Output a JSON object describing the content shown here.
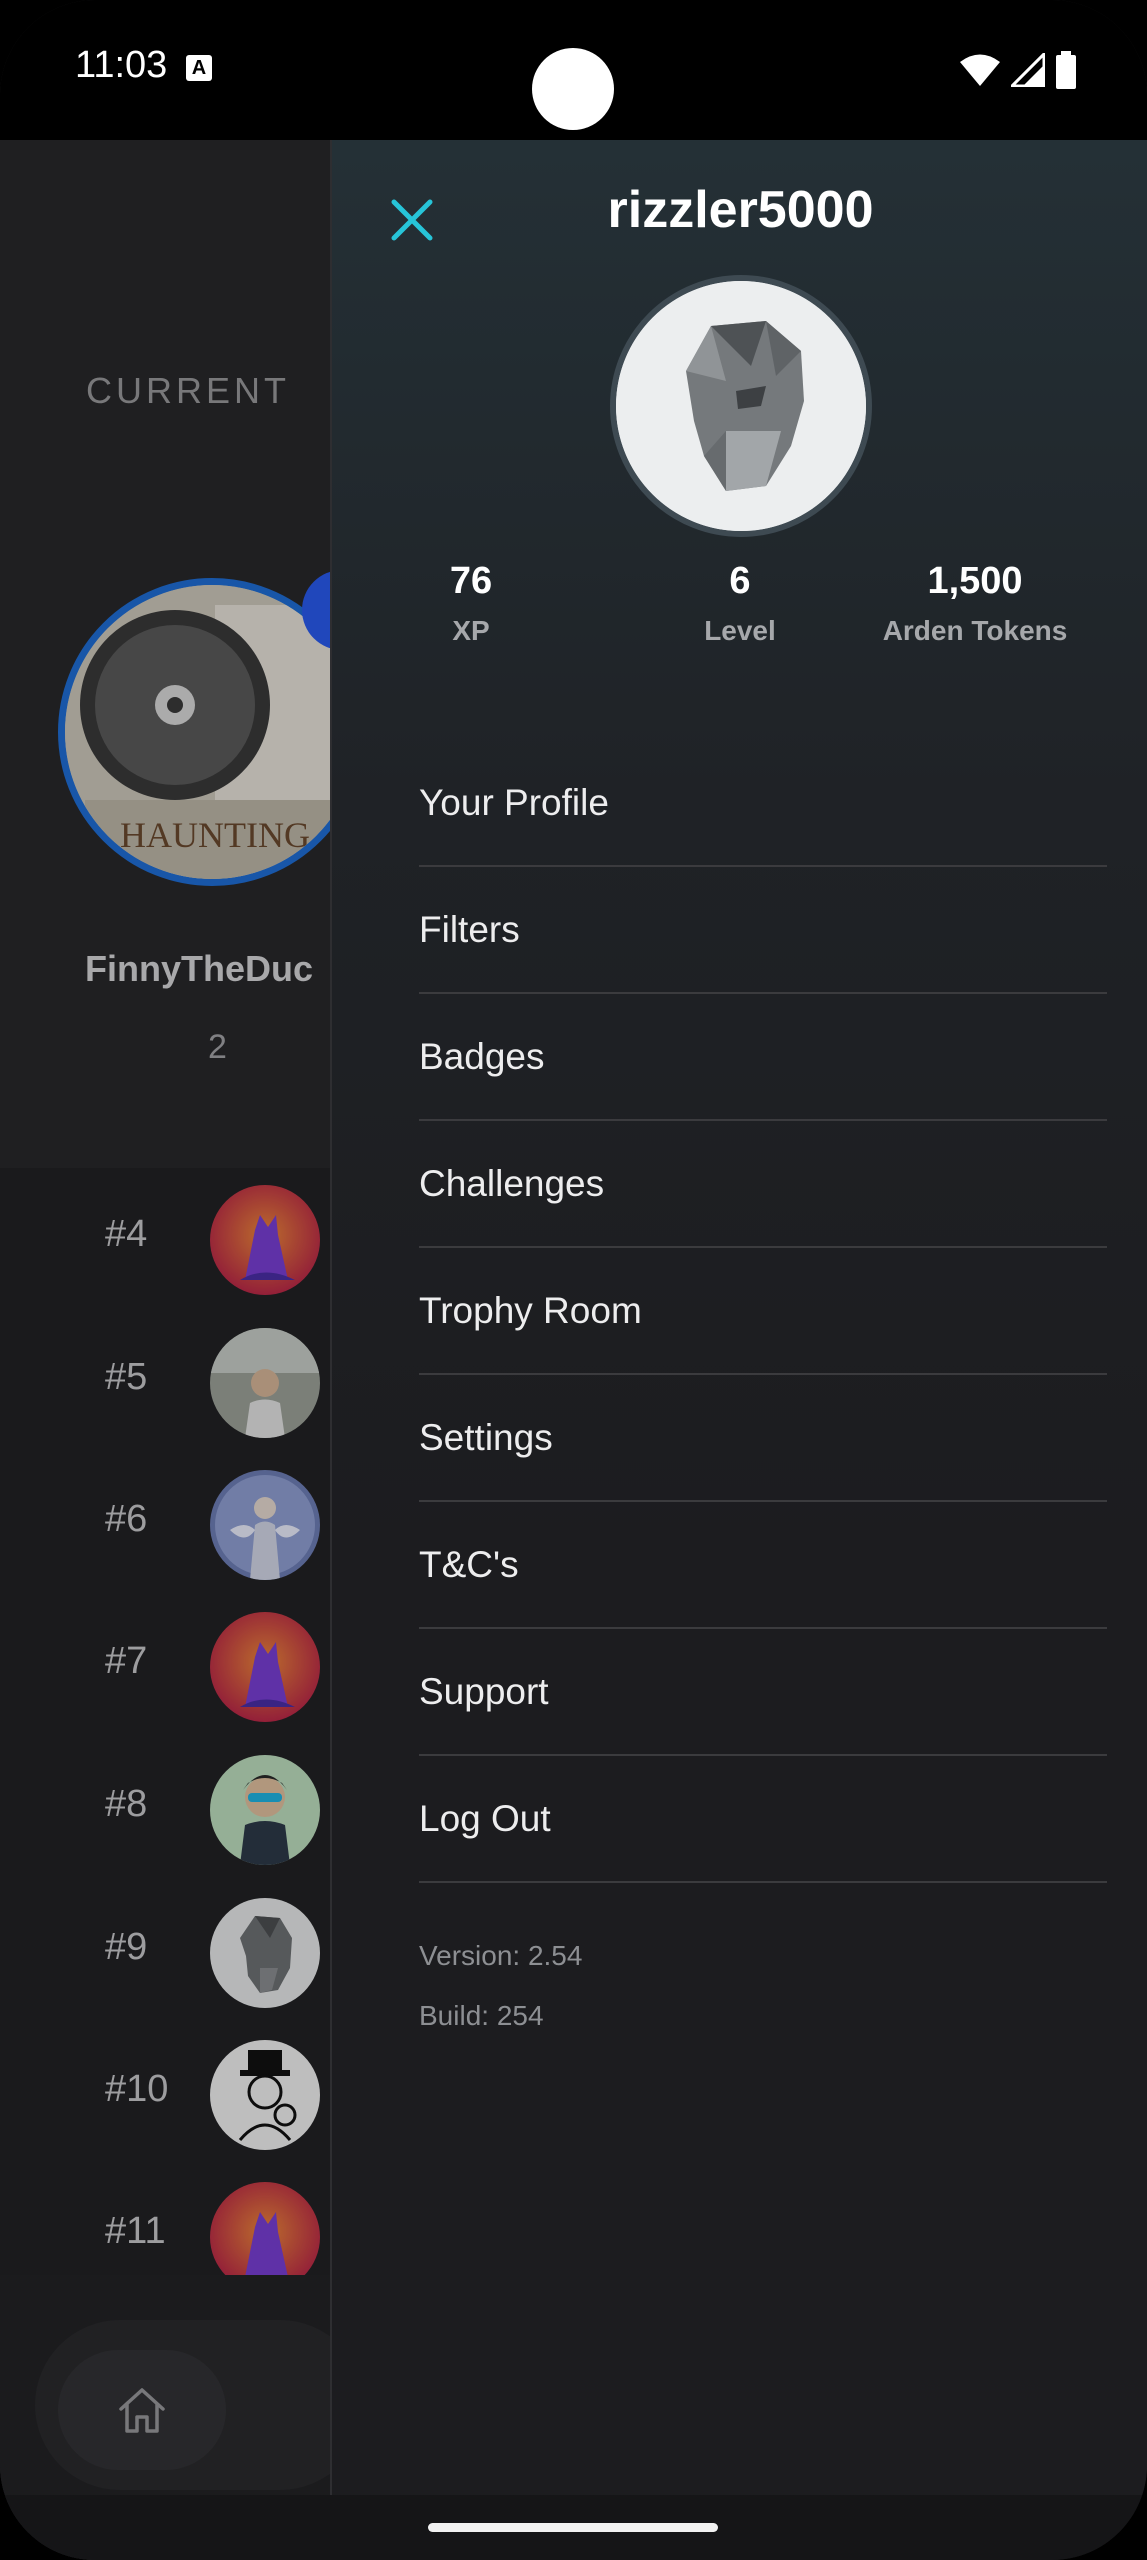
{
  "status_bar": {
    "time": "11:03",
    "notification_icon_letter": "A"
  },
  "background": {
    "section_label": "CURRENT",
    "featured_user": {
      "name": "FinnyTheDuc",
      "count": "2"
    },
    "ranks": [
      {
        "rank": "#4",
        "avatar": "purple-dog-avatar"
      },
      {
        "rank": "#5",
        "avatar": "person-outdoors-avatar"
      },
      {
        "rank": "#6",
        "avatar": "angel-avatar"
      },
      {
        "rank": "#7",
        "avatar": "purple-dog-avatar"
      },
      {
        "rank": "#8",
        "avatar": "cartoon-guy-avatar"
      },
      {
        "rank": "#9",
        "avatar": "statue-avatar"
      },
      {
        "rank": "#10",
        "avatar": "monopoly-avatar"
      },
      {
        "rank": "#11",
        "avatar": "purple-dog-avatar"
      }
    ]
  },
  "drawer": {
    "username": "rizzler5000",
    "stats": [
      {
        "value": "76",
        "label": "XP"
      },
      {
        "value": "6",
        "label": "Level"
      },
      {
        "value": "1,500",
        "label": "Arden Tokens"
      }
    ],
    "menu": [
      "Your Profile",
      "Filters",
      "Badges",
      "Challenges",
      "Trophy Room",
      "Settings",
      "T&C's",
      "Support",
      "Log Out"
    ],
    "version": "Version: 2.54",
    "build": "Build: 254"
  },
  "colors": {
    "accent_close": "#27c4d8",
    "avatar_ring": "#1f6fd8",
    "drawer_bg": "#1c1c1f"
  }
}
